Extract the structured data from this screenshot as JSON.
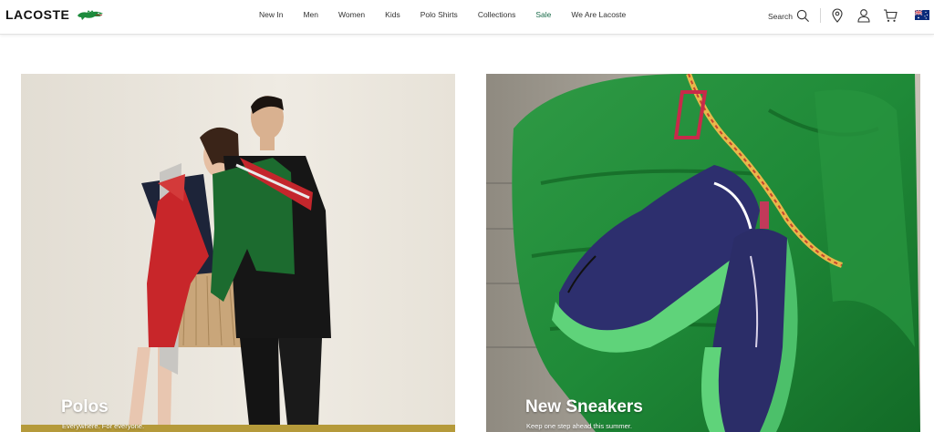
{
  "brand": {
    "name": "LACOSTE",
    "logo_icon": "crocodile-icon"
  },
  "nav": {
    "items": [
      {
        "label": "New In"
      },
      {
        "label": "Men"
      },
      {
        "label": "Women"
      },
      {
        "label": "Kids"
      },
      {
        "label": "Polo Shirts"
      },
      {
        "label": "Collections"
      },
      {
        "label": "Sale"
      },
      {
        "label": "We Are Lacoste"
      }
    ]
  },
  "header": {
    "search_label": "Search",
    "icons": [
      "search-icon",
      "location-pin-icon",
      "account-icon",
      "cart-icon",
      "australia-flag-icon"
    ]
  },
  "cards": [
    {
      "title": "Polos",
      "subtitle": "Everywhere. For everyone."
    },
    {
      "title": "New Sneakers",
      "subtitle": "Keep one step ahead this summer."
    }
  ],
  "colors": {
    "accent_sale": "#1a6b4a",
    "brand_green": "#1c8b3c"
  }
}
